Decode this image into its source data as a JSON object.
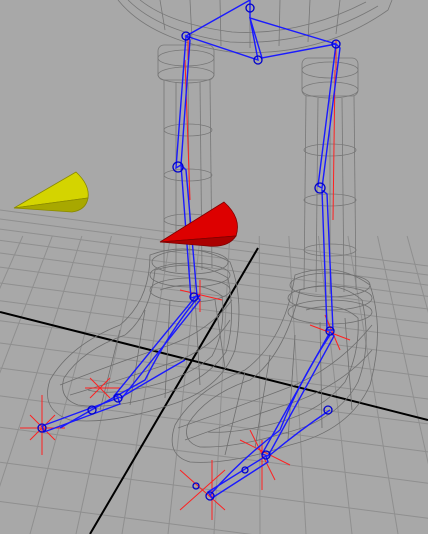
{
  "viewport": {
    "background": "#a8a8a8",
    "grid_color": "#8f8f8f",
    "axis_color": "#000000",
    "wireframe_color": "#777777",
    "bone_color": "#1a1aff",
    "joint_color": "#0000cc",
    "locator_color": "#ff2020",
    "control_left_color": "#d4d400",
    "control_right_color": "#cc0000"
  },
  "objects": [
    {
      "name": "body-wireframe"
    },
    {
      "name": "left-leg-wireframe"
    },
    {
      "name": "right-leg-wireframe"
    },
    {
      "name": "left-shoe-wireframe"
    },
    {
      "name": "right-shoe-wireframe"
    },
    {
      "name": "skeleton-joints"
    },
    {
      "name": "left-foot-control"
    },
    {
      "name": "right-foot-control"
    }
  ]
}
